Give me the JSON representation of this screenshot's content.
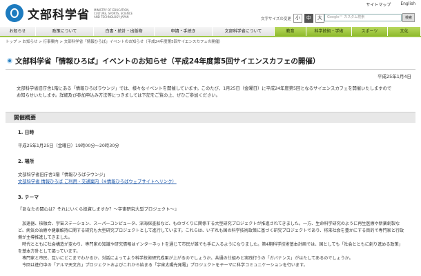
{
  "header": {
    "logo_text": "文部科学省",
    "logo_en": "MINISTRY OF EDUCATION, CULTURE, SPORTS, SCIENCE AND TECHNOLOGY-JAPAN",
    "util_links": [
      "サイトマップ",
      "English"
    ],
    "fontsize_label": "文字サイズの変更",
    "fontsize_buttons": [
      "小",
      "中",
      "大"
    ],
    "search_placeholder": "Google™ カスタム検索",
    "search_button": "検索"
  },
  "nav": {
    "items": [
      "お知らせ",
      "政策について",
      "白書・統計・出版物",
      "申請・手続き",
      "文部科学省について",
      "教育",
      "科学技術・学術",
      "スポーツ",
      "文化"
    ]
  },
  "breadcrumb": "トップ > お知らせ > 行事案内 > 文部科学省「情報ひろば」イベントのお知らせ（平成24年度第5回サイエンスカフェの開催）",
  "page": {
    "title": "文部科学省「情報ひろば」イベントのお知らせ（平成24年度第5回サイエンスカフェの開催）",
    "date": "平成25年1月4日",
    "intro_1": "文部科学省旧庁舎1階にある「情報ひろばラウンジ」では、様々なイベントを開催しています。このたび、1月25日（金曜日）に平成24年度第5回となるサイエンスカフェを開催いたしますので",
    "intro_2": "お知らせいたします。詳細及び参加申込み方法等につきましては下記をご覧の上、ぜひご参加ください。",
    "section_title": "開催概要",
    "sub1_title": "1. 日時",
    "sub1_text": "平成25年1月25日（金曜日）19時00分～20時30分",
    "sub2_title": "2. 場所",
    "sub2_text": "文部科学省旧庁舎1階「情報ひろばラウンジ」",
    "sub2_link": "文部科学省 情報ひろば ご利用・交通案内（※情報ひろばウェブサイトへリンク）",
    "sub3_title": "3. テーマ",
    "sub3_text": "『あなたの関心は？それにいくら投資しますか？～宇宙研究大型プロジェクト～』",
    "para_1": "加速器、核融合、宇宙ステーション、スーパーコンピュータ、深海探査船など、ものづくりに関係する大型研究プロジェクトが推進されてきました。一方、生命科学研究のように再生医療や新薬創製など、病気の治療や健康維持に関する研究も大型研究プロジェクトとして進行しています。これらは、いずれも国の科学技術政策に基づく研究プロジェクトであり、将来社会を豊かにする目的で専門家と行政側が主導推進してきました。",
    "para_2": "時代とともに社会構造が変わり、専門家の知識や研究情報はインターネットを通じて市民が誰でも手に入るようになりました。第4期科学技術基本計画では、国としても「社会とともに創り進める政策」を基本方針として謳っています。",
    "para_3": "専門家と市民、互いにどこまでわかるか、対話によってより科学技術研究成果が上がるのでしょうか。共通の仕組みと実践行うの「ガバナンス」がはたしてあるのでしょうか。",
    "para_4": "今回は進行中の「アルマ天文台」プロジェクトおよびこれから始まる「宇宙太陽光発電」プロジェクトをテーマに科学コミュニケーションを行います。"
  }
}
